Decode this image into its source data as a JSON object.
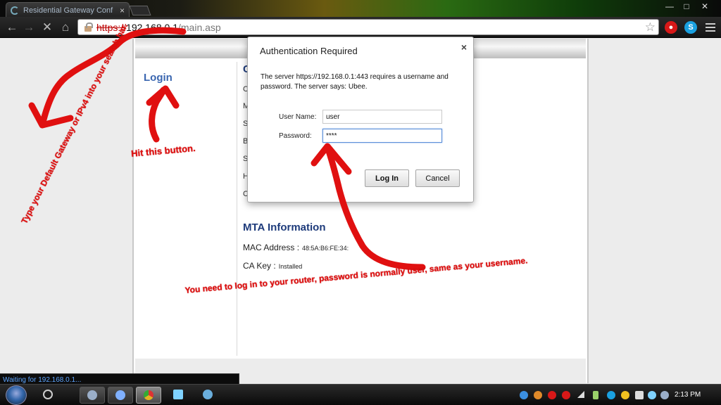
{
  "browser": {
    "tab_title": "Residential Gateway Conf",
    "tab_close": "×",
    "window_buttons": {
      "minimize": "—",
      "maximize": "□",
      "close": "✕"
    },
    "nav": {
      "back": "←",
      "forward": "→",
      "stop": "✕",
      "home": "⌂"
    },
    "url": {
      "scheme": "https://",
      "host": "192.168.0.1",
      "path": "/main.asp"
    },
    "star": "☆",
    "extensions": [
      {
        "name": "adblock-icon",
        "label": "●",
        "color": "#d81818"
      },
      {
        "name": "skype-icon",
        "label": "S",
        "color": "#1aa0e0"
      }
    ]
  },
  "page": {
    "login_link": "Login",
    "section_initial": "C",
    "side_letters": [
      "C",
      "M",
      "S",
      "B",
      "S",
      "H",
      "C"
    ],
    "mta": {
      "title": "MTA Information",
      "mac_label": "MAC Address :",
      "mac_value": "48:5A:B6:FE:34:",
      "ca_label": "CA Key :",
      "ca_value": "Installed"
    }
  },
  "dialog": {
    "title": "Authentication Required",
    "close": "×",
    "message": "The server https://192.168.0.1:443 requires a username and password. The server says: Ubee.",
    "username_label": "User Name:",
    "username_value": "user",
    "password_label": "Password:",
    "password_value": "****",
    "login_button": "Log In",
    "cancel_button": "Cancel"
  },
  "annotations": {
    "address_bar_note": "Type your Default Gateway or IPv4 into your search bar.",
    "login_note": "Hit this button.",
    "password_note": "You need to log in to your router, password is normally user, same as your username.",
    "color": "#e01010"
  },
  "status": {
    "text": "Waiting for 192.168.0.1..."
  },
  "taskbar": {
    "clock": "2:13 PM",
    "apps": [
      {
        "name": "taskbar-app-search",
        "color": "#cfcfcf"
      },
      {
        "name": "taskbar-app-steam",
        "color": "#9aaec8"
      },
      {
        "name": "taskbar-app-media",
        "color": "#7fb0ff"
      },
      {
        "name": "taskbar-app-chrome",
        "color": "#e4b321"
      },
      {
        "name": "taskbar-app-keyboard",
        "color": "#7fd2ff"
      },
      {
        "name": "taskbar-app-gear",
        "color": "#6aaedc"
      }
    ],
    "tray": [
      {
        "name": "tray-globe-icon",
        "color": "#3b8fe0"
      },
      {
        "name": "tray-bag-icon",
        "color": "#e08a2a"
      },
      {
        "name": "tray-beats-icon",
        "color": "#d81818"
      },
      {
        "name": "tray-adblock-icon",
        "color": "#d81818"
      },
      {
        "name": "tray-network-icon",
        "color": "#dddddd"
      },
      {
        "name": "tray-battery-icon",
        "color": "#9bd16a"
      },
      {
        "name": "tray-skype-icon",
        "color": "#1aa0e0"
      },
      {
        "name": "tray-norton-icon",
        "color": "#f0c020"
      },
      {
        "name": "tray-volume-icon",
        "color": "#dddddd"
      },
      {
        "name": "tray-snowflake-icon",
        "color": "#7fd2ff"
      },
      {
        "name": "tray-steam-icon",
        "color": "#9aaec8"
      }
    ]
  }
}
